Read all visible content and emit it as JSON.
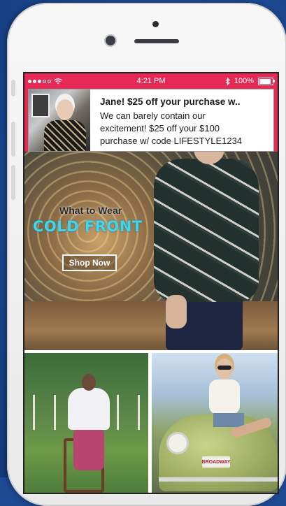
{
  "status_bar": {
    "time": "4:21 PM",
    "battery": "100%",
    "battery_level": 1.0
  },
  "notification": {
    "title": "Jane! $25 off your purchase w..",
    "line1": "We can barely contain our",
    "line2": "excitement! $25 off your $100",
    "line3": "purchase w/ code LIFESTYLE1234"
  },
  "hero": {
    "kicker": "What to Wear",
    "title": "COLD FRONT",
    "cta": "Shop Now"
  },
  "tiles": {
    "plate_text": "BROADWAY"
  },
  "colors": {
    "accent": "#e62a55",
    "hero_title": "#3fd6ee",
    "background": "#1c4a93"
  },
  "icons": [
    "wifi-icon",
    "bluetooth-icon",
    "battery-icon",
    "signal-dots-icon",
    "camera-icon",
    "speaker-icon"
  ]
}
